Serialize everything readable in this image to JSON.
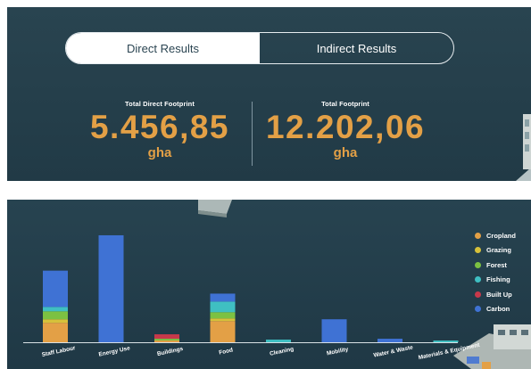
{
  "tabs": [
    {
      "label": "Direct Results",
      "active": true
    },
    {
      "label": "Indirect Results",
      "active": false
    }
  ],
  "metrics": {
    "direct": {
      "label": "Total Direct Footprint",
      "value": "5.456,85",
      "unit": "gha"
    },
    "total": {
      "label": "Total Footprint",
      "value": "12.202,06",
      "unit": "gha"
    }
  },
  "colors": {
    "accent": "#e3a046",
    "panel": "#25404c",
    "Cropland": "#e3a046",
    "Grazing": "#d6c13a",
    "Forest": "#7cc142",
    "Fishing": "#3fbfc2",
    "Built Up": "#c7384a",
    "Carbon": "#3f72d4"
  },
  "chart_data": {
    "type": "bar",
    "stacked": true,
    "categories": [
      "Staff Labour",
      "Energy Use",
      "Buildings",
      "Food",
      "Cleaning",
      "Mobility",
      "Water & Waste",
      "Materials & Equipment"
    ],
    "series": [
      {
        "name": "Cropland",
        "values": [
          22,
          0,
          2,
          24,
          0,
          0,
          0,
          0
        ]
      },
      {
        "name": "Grazing",
        "values": [
          4,
          0,
          0,
          3,
          0,
          0,
          0,
          0
        ]
      },
      {
        "name": "Forest",
        "values": [
          9,
          0,
          2,
          7,
          0,
          0,
          0,
          0
        ]
      },
      {
        "name": "Fishing",
        "values": [
          5,
          0,
          0,
          12,
          3,
          0,
          0,
          2
        ]
      },
      {
        "name": "Built Up",
        "values": [
          0,
          0,
          5,
          0,
          0,
          0,
          0,
          0
        ]
      },
      {
        "name": "Carbon",
        "values": [
          41,
          121,
          0,
          9,
          0,
          26,
          4,
          0
        ]
      }
    ],
    "legend_position": "right",
    "grid": false
  }
}
